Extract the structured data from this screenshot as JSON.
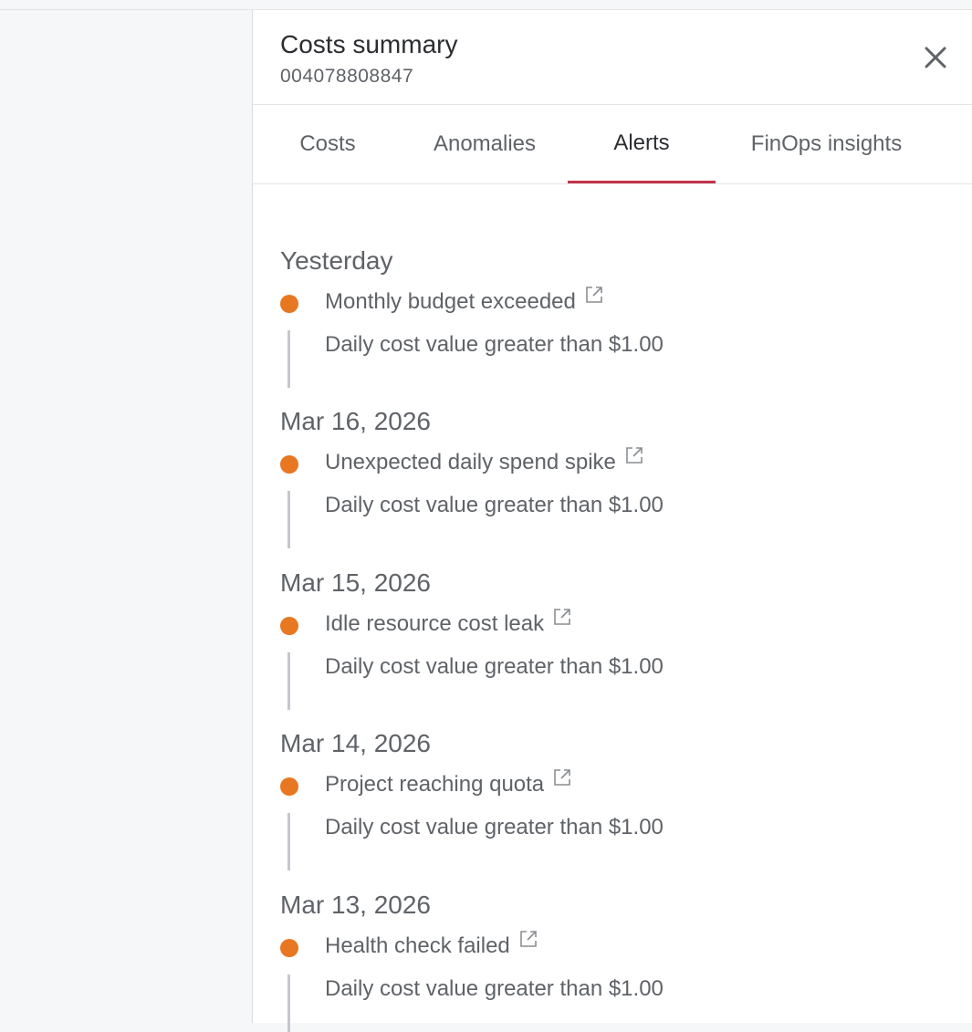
{
  "panel": {
    "title": "Costs summary",
    "subtitle": "004078808847",
    "close_icon": "close-icon"
  },
  "tabs": [
    {
      "label": "Costs",
      "active": false
    },
    {
      "label": "Anomalies",
      "active": false
    },
    {
      "label": "Alerts",
      "active": true
    },
    {
      "label": "FinOps insights",
      "active": false
    }
  ],
  "alerts": [
    {
      "date": "Yesterday",
      "name": "Monthly budget exceeded",
      "description": "Daily cost value greater than $1.00"
    },
    {
      "date": "Mar 16, 2026",
      "name": "Unexpected daily spend spike",
      "description": "Daily cost value greater than $1.00"
    },
    {
      "date": "Mar 15, 2026",
      "name": "Idle resource cost leak",
      "description": "Daily cost value greater than $1.00"
    },
    {
      "date": "Mar 14, 2026",
      "name": "Project reaching quota",
      "description": "Daily cost value greater than $1.00"
    },
    {
      "date": "Mar 13, 2026",
      "name": "Health check failed",
      "description": "Daily cost value greater than $1.00"
    }
  ],
  "colors": {
    "accent": "#c2354a",
    "alert_dot": "#e87722"
  }
}
